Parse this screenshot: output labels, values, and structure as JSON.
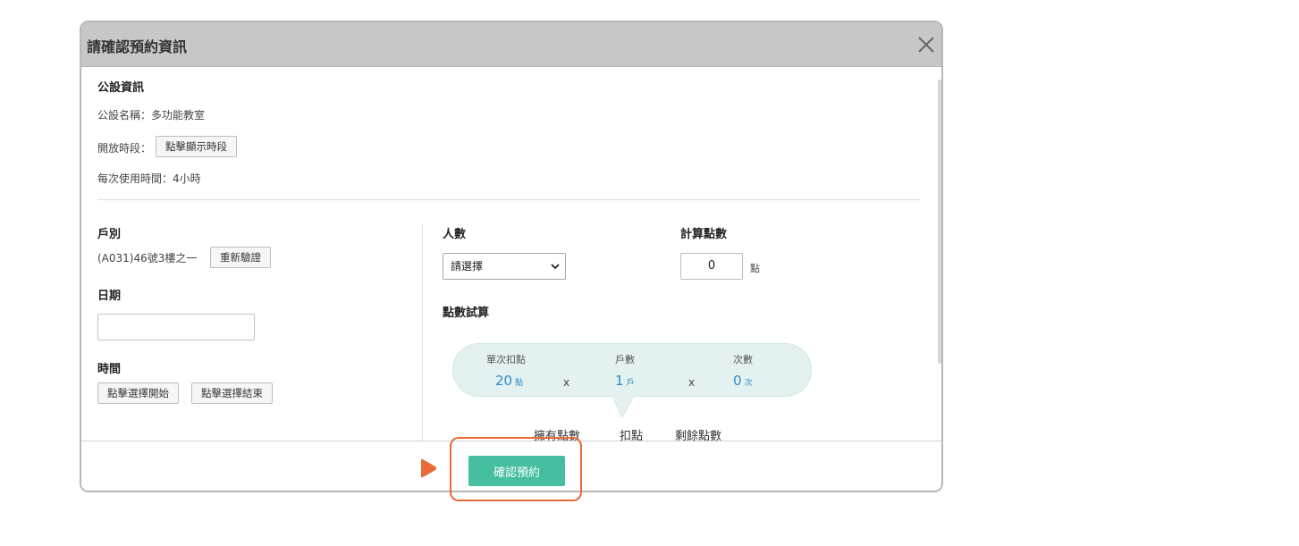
{
  "modal": {
    "title": "請確認預約資訊",
    "close_icon": "close-icon"
  },
  "facility": {
    "section_title": "公設資訊",
    "name_line": "公設名稱：多功能教室",
    "hours_label": "開放時段：",
    "hours_button": "點擊顯示時段",
    "duration_line": "每次使用時間：4小時"
  },
  "household": {
    "label": "戶別",
    "value": "(A031)46號3樓之一",
    "reverify_button": "重新驗證"
  },
  "date": {
    "label": "日期",
    "value": ""
  },
  "time": {
    "label": "時間",
    "start_button": "點擊選擇開始",
    "end_button": "點擊選擇結束"
  },
  "people": {
    "label": "人數",
    "selected": "請選擇"
  },
  "points_calc": {
    "label": "計算點數",
    "value": "0",
    "unit": "點"
  },
  "trial": {
    "section_title": "點數試算",
    "per_use_label": "單次扣點",
    "per_use_value": "20",
    "per_use_unit": "點",
    "households_label": "戶數",
    "households_value": "1",
    "households_unit": "戶",
    "times_label": "次數",
    "times_value": "0",
    "times_unit": "次",
    "multiply": "x"
  },
  "summary": {
    "owned": "擁有點數",
    "deduct": "扣點",
    "remaining": "剩餘點數"
  },
  "footer": {
    "confirm_button": "確認預約"
  },
  "colors": {
    "accent": "#45bf9f",
    "highlight": "#e86a36",
    "value_blue": "#2e8bc9",
    "bubble_bg": "#e3f2f0",
    "header_bg": "#c7c7c7"
  }
}
